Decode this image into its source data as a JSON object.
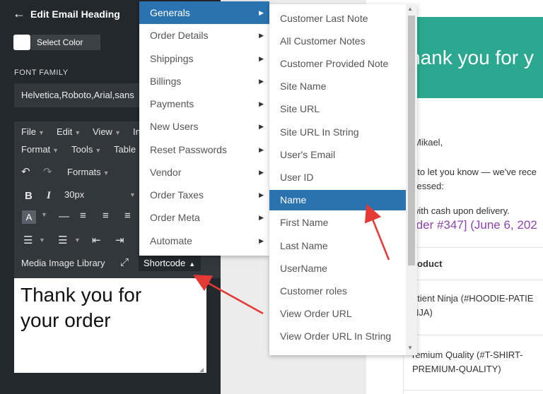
{
  "header": {
    "back_icon": "arrow-left-icon",
    "title": "Edit Email Heading"
  },
  "color": {
    "button_label": "Select Color",
    "swatch": "#ffffff"
  },
  "font_family": {
    "label": "FONT FAMILY",
    "value": "Helvetica,Roboto,Arial,sans"
  },
  "editor": {
    "menus": [
      "File",
      "Edit",
      "View",
      "In"
    ],
    "menus2": [
      "Format",
      "Tools",
      "Table"
    ],
    "formats_label": "Formats",
    "font_size": "30px",
    "bold": "B",
    "italic": "I",
    "a_button": "A",
    "media_label": "Media Image Library",
    "shortcode_label": "Shortcode",
    "content_line1": "Thank you for",
    "content_line2": "your order"
  },
  "menu_primary": {
    "items": [
      "Generals",
      "Order Details",
      "Shippings",
      "Billings",
      "Payments",
      "New Users",
      "Reset Passwords",
      "Vendor",
      "Order Taxes",
      "Order Meta",
      "Automate"
    ],
    "active_index": 0
  },
  "menu_secondary": {
    "items": [
      "Customer Last Note",
      "All Customer Notes",
      "Customer Provided Note",
      "Site Name",
      "Site URL",
      "Site URL In String",
      "User's Email",
      "User ID",
      "Name",
      "First Name",
      "Last Name",
      "UserName",
      "Customer roles",
      "View Order URL",
      "View Order URL In String"
    ],
    "active_index": 8
  },
  "preview": {
    "banner": "hank you for y",
    "greeting": "Mikael,",
    "line1": "t to let you know — we've rece",
    "line2": "cessed:",
    "line3": "with cash upon delivery.",
    "order_link": "rder #347] (June 6, 202",
    "table_header": "roduct",
    "row1_a": "atient Ninja (#HOODIE-PATIE",
    "row1_b": "NJA)",
    "row2_a": "remium Quality (#T-SHIRT-",
    "row2_b": "PREMIUM-QUALITY)"
  },
  "colors": {
    "panel": "#23282d",
    "accent": "#2a72b0",
    "banner": "#2ba88f",
    "link": "#8e44ad",
    "arrow": "#e53935"
  }
}
